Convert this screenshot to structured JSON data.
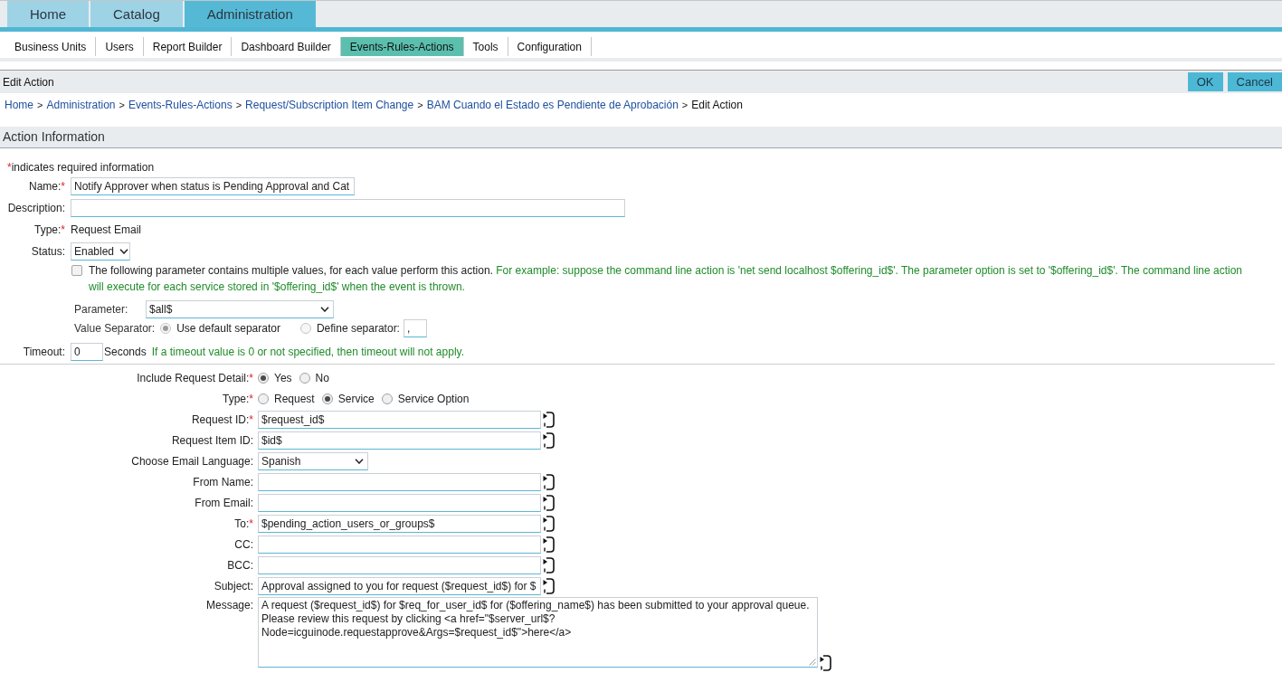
{
  "top_tabs": [
    {
      "label": "Home",
      "selected": false
    },
    {
      "label": "Catalog",
      "selected": false
    },
    {
      "label": "Administration",
      "selected": true
    }
  ],
  "sub_nav": [
    {
      "label": "Business Units",
      "selected": false
    },
    {
      "label": "Users",
      "selected": false
    },
    {
      "label": "Report Builder",
      "selected": false
    },
    {
      "label": "Dashboard Builder",
      "selected": false
    },
    {
      "label": "Events-Rules-Actions",
      "selected": true
    },
    {
      "label": "Tools",
      "selected": false
    },
    {
      "label": "Configuration",
      "selected": false
    }
  ],
  "page_header": {
    "title": "Edit Action",
    "buttons": [
      {
        "label": "OK"
      },
      {
        "label": "Cancel"
      }
    ]
  },
  "breadcrumb": [
    {
      "kind": "link",
      "text": "Home"
    },
    {
      "kind": "separator",
      "text": ">"
    },
    {
      "kind": "link",
      "text": "Administration"
    },
    {
      "kind": "separator",
      "text": ">"
    },
    {
      "kind": "link",
      "text": "Events-Rules-Actions"
    },
    {
      "kind": "separator",
      "text": ">"
    },
    {
      "kind": "link",
      "text": "Request/Subscription Item Change"
    },
    {
      "kind": "separator",
      "text": ">"
    },
    {
      "kind": "link",
      "text": "BAM Cuando el Estado es Pendiente de Aprobación"
    },
    {
      "kind": "separator",
      "text": ">"
    },
    {
      "kind": "current",
      "text": "Edit Action"
    }
  ],
  "section": {
    "title": "Action Information"
  },
  "required_note": {
    "mark": "*",
    "text": "indicates required information"
  },
  "action_info": {
    "name": {
      "label": "Name:",
      "required_mark": "*",
      "value": "Notify Approver when status is Pending Approval and Cat"
    },
    "description": {
      "label": "Description:"
    },
    "type": {
      "label": "Type:",
      "required_mark": "*",
      "value": "Request Email"
    },
    "status": {
      "label": "Status:",
      "value": "Enabled"
    },
    "multi_value": {
      "checked": false,
      "label": "The following parameter contains multiple values, for each value perform this action.",
      "note": "For example: suppose the command line action is 'net send localhost $offering_id$'. The parameter option is set to '$offering_id$'. The command line action will execute for each service stored in '$offering_id$' when the event is thrown."
    },
    "parameter": {
      "label": "Parameter:",
      "value": "$all$"
    },
    "value_separator": {
      "label": "Value Separator:",
      "options": [
        {
          "label": "Use default separator",
          "selected": true,
          "disabled": true
        },
        {
          "label": "Define separator:",
          "selected": false,
          "disabled": true
        }
      ],
      "custom_value": ","
    },
    "timeout": {
      "label": "Timeout:",
      "value": "0",
      "unit": "Seconds",
      "note": "If a timeout value is 0 or not specified, then timeout will not apply."
    }
  },
  "email_fields": [
    {
      "kind": "radio",
      "label": "Include Request Detail:",
      "required_mark": "*",
      "options": [
        {
          "label": "Yes",
          "selected": true
        },
        {
          "label": "No",
          "selected": false
        }
      ]
    },
    {
      "kind": "radio",
      "label": "Type:",
      "required_mark": "*",
      "options": [
        {
          "label": "Request",
          "selected": false
        },
        {
          "label": "Service",
          "selected": true
        },
        {
          "label": "Service Option",
          "selected": false
        }
      ]
    },
    {
      "kind": "input",
      "label": "Request ID:",
      "required_mark": "*",
      "value": "$request_id$"
    },
    {
      "kind": "input",
      "label": "Request Item ID:",
      "value": "$id$"
    },
    {
      "kind": "select",
      "label": "Choose Email Language:",
      "value": "Spanish"
    },
    {
      "kind": "input",
      "label": "From Name:"
    },
    {
      "kind": "input",
      "label": "From Email:"
    },
    {
      "kind": "input",
      "label": "To:",
      "required_mark": "*",
      "value": "$pending_action_users_or_groups$"
    },
    {
      "kind": "input",
      "label": "CC:"
    },
    {
      "kind": "input",
      "label": "BCC:"
    },
    {
      "kind": "input",
      "label": "Subject:",
      "value": "Approval assigned to you for request ($request_id$) for $"
    },
    {
      "kind": "textarea",
      "label": "Message:",
      "value": "A request ($request_id$) for $req_for_user_id$ for ($offering_name$) has been submitted to your approval queue. Please review this request by clicking <a href=\"$server_url$?Node=icguinode.requestapprove&Args=$request_id$\">here</a>"
    }
  ]
}
